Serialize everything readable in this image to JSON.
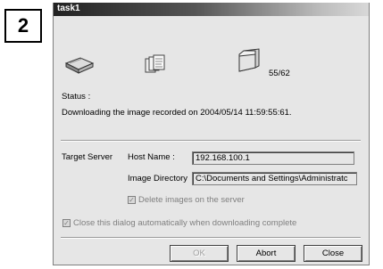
{
  "step_number": "2",
  "window": {
    "title": "task1"
  },
  "progress": {
    "counter": "55/62",
    "current": 55,
    "total": 62
  },
  "status": {
    "label": "Status :",
    "message": "Downloading the image recorded on 2004/05/14 11:59:55:61."
  },
  "target": {
    "section_label": "Target Server",
    "host_label": "Host Name :",
    "host_value": "192.168.100.1",
    "dir_label": "Image Directory",
    "dir_value": "C:\\Documents and Settings\\Administratc"
  },
  "options": {
    "delete_label": "Delete images on the server",
    "delete_checked": true,
    "close_label": "Close this dialog automatically when downloading complete",
    "close_checked": true
  },
  "buttons": {
    "ok": "OK",
    "abort": "Abort",
    "close": "Close"
  },
  "icons": {
    "source": "camera-device-icon",
    "transfer": "transfer-pages-icon",
    "destination": "folder-icon"
  }
}
